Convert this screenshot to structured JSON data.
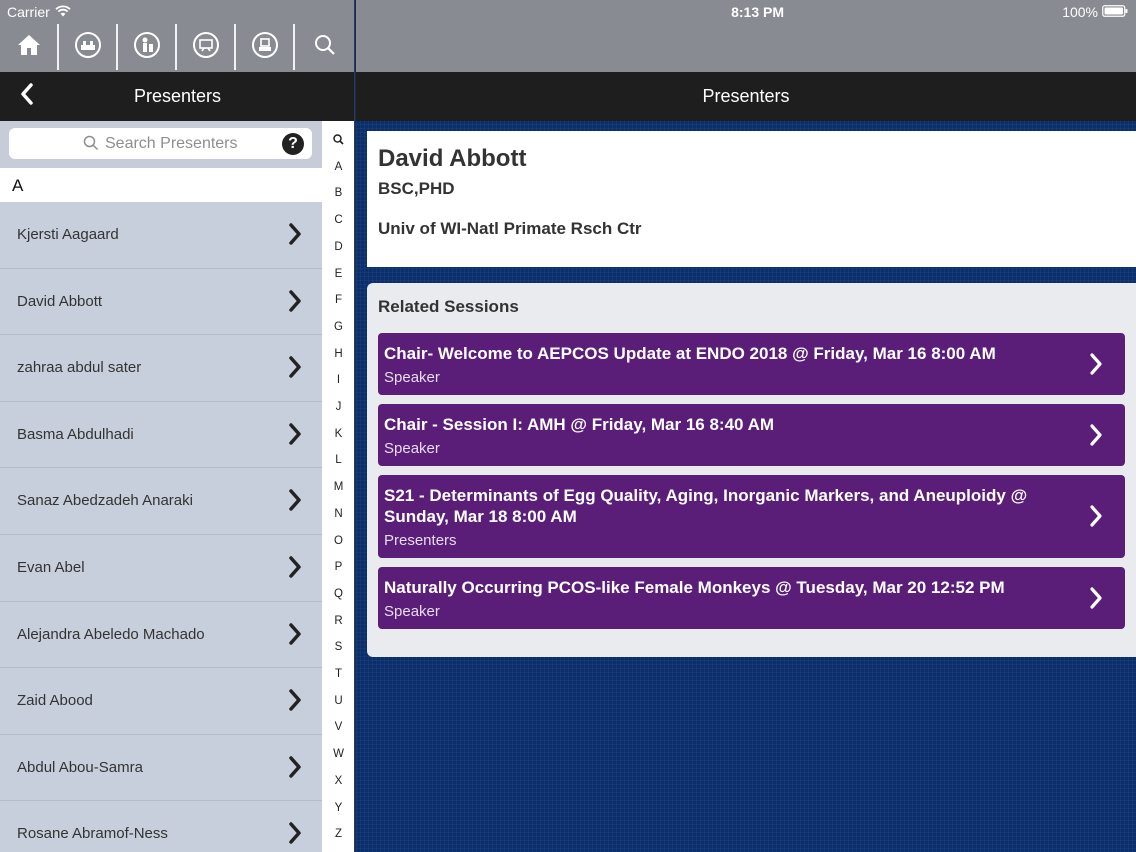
{
  "status": {
    "carrier": "Carrier",
    "time": "8:13 PM",
    "battery": "100%"
  },
  "toolbar": {
    "items": [
      {
        "icon": "home-icon"
      },
      {
        "icon": "exhibit-hall-icon"
      },
      {
        "icon": "speaker-icon"
      },
      {
        "icon": "schedule-board-icon"
      },
      {
        "icon": "poster-icon"
      },
      {
        "icon": "search-icon"
      }
    ]
  },
  "left_nav": {
    "title": "Presenters"
  },
  "search": {
    "placeholder": "Search Presenters"
  },
  "section": {
    "letter": "A"
  },
  "presenters": [
    "Kjersti Aagaard",
    "David Abbott",
    "zahraa abdul sater",
    "Basma Abdulhadi",
    "Sanaz Abedzadeh Anaraki",
    "Evan Abel",
    "Alejandra Abeledo Machado",
    "Zaid Abood",
    "Abdul Abou-Samra",
    "Rosane Abramof-Ness"
  ],
  "index": [
    "Q",
    "A",
    "B",
    "C",
    "D",
    "E",
    "F",
    "G",
    "H",
    "I",
    "J",
    "K",
    "L",
    "M",
    "N",
    "O",
    "P",
    "Q",
    "R",
    "S",
    "T",
    "U",
    "V",
    "W",
    "X",
    "Y",
    "Z"
  ],
  "right_nav": {
    "title": "Presenters"
  },
  "presenter": {
    "name": "David Abbott",
    "degree": "BSC,PHD",
    "organization": "Univ of WI-Natl Primate Rsch Ctr"
  },
  "related": {
    "title": "Related Sessions",
    "sessions": [
      {
        "title": "Chair- Welcome to AEPCOS Update at ENDO 2018 @ Friday, Mar 16 8:00 AM",
        "role": "Speaker"
      },
      {
        "title": "Chair - Session I: AMH @ Friday, Mar 16 8:40 AM",
        "role": "Speaker"
      },
      {
        "title": "S21 - Determinants of Egg Quality, Aging, Inorganic Markers, and Aneuploidy @ Sunday, Mar 18 8:00 AM",
        "role": "Presenters"
      },
      {
        "title": "Naturally Occurring PCOS-like Female Monkeys @ Tuesday, Mar 20 12:52 PM",
        "role": "Speaker"
      }
    ]
  },
  "colors": {
    "session_bg": "#5a1e78",
    "navbar": "#1e1e1e",
    "list_bg": "#c8cfdc",
    "right_bg": "#0a2f6c"
  }
}
